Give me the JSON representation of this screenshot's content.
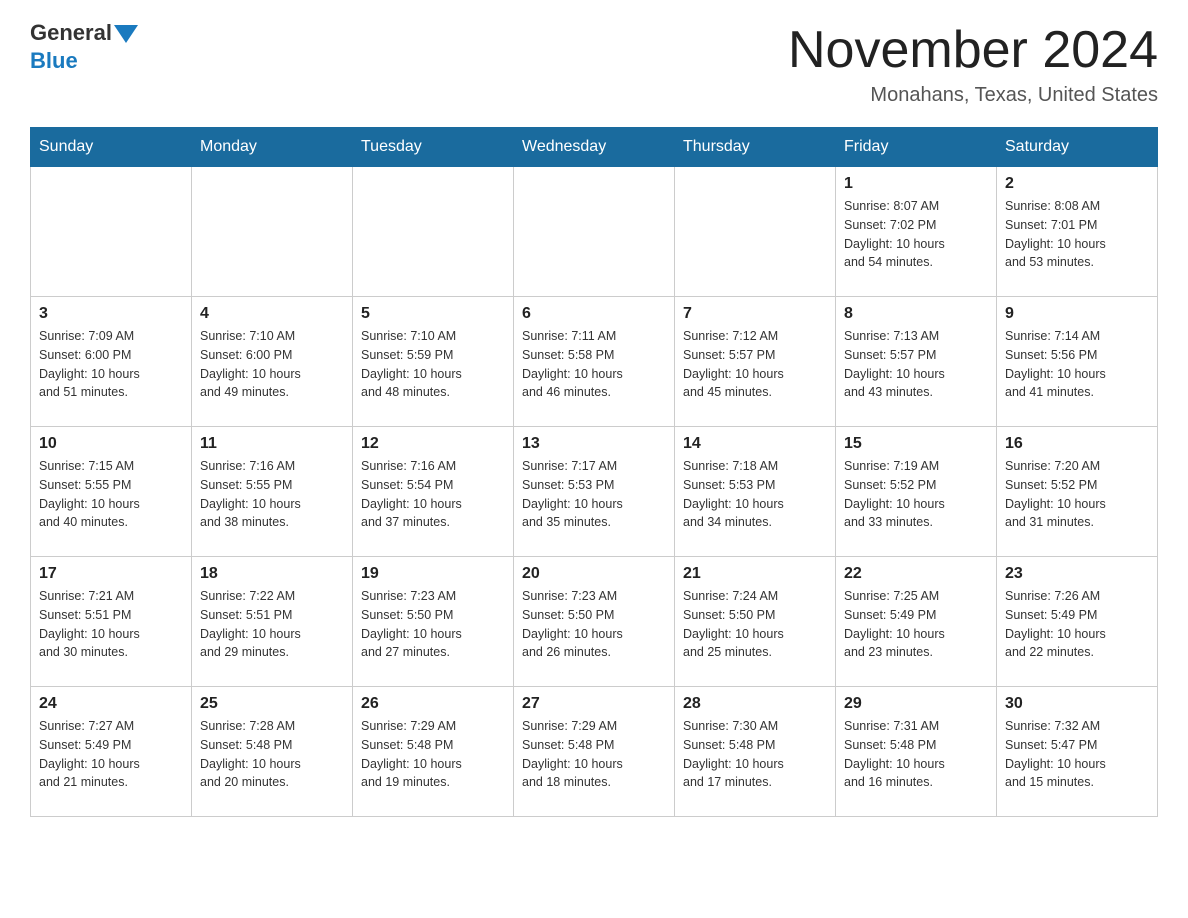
{
  "header": {
    "logo_general": "General",
    "logo_blue": "Blue",
    "title": "November 2024",
    "subtitle": "Monahans, Texas, United States"
  },
  "weekdays": [
    "Sunday",
    "Monday",
    "Tuesday",
    "Wednesday",
    "Thursday",
    "Friday",
    "Saturday"
  ],
  "weeks": [
    [
      {
        "day": "",
        "info": ""
      },
      {
        "day": "",
        "info": ""
      },
      {
        "day": "",
        "info": ""
      },
      {
        "day": "",
        "info": ""
      },
      {
        "day": "",
        "info": ""
      },
      {
        "day": "1",
        "info": "Sunrise: 8:07 AM\nSunset: 7:02 PM\nDaylight: 10 hours\nand 54 minutes."
      },
      {
        "day": "2",
        "info": "Sunrise: 8:08 AM\nSunset: 7:01 PM\nDaylight: 10 hours\nand 53 minutes."
      }
    ],
    [
      {
        "day": "3",
        "info": "Sunrise: 7:09 AM\nSunset: 6:00 PM\nDaylight: 10 hours\nand 51 minutes."
      },
      {
        "day": "4",
        "info": "Sunrise: 7:10 AM\nSunset: 6:00 PM\nDaylight: 10 hours\nand 49 minutes."
      },
      {
        "day": "5",
        "info": "Sunrise: 7:10 AM\nSunset: 5:59 PM\nDaylight: 10 hours\nand 48 minutes."
      },
      {
        "day": "6",
        "info": "Sunrise: 7:11 AM\nSunset: 5:58 PM\nDaylight: 10 hours\nand 46 minutes."
      },
      {
        "day": "7",
        "info": "Sunrise: 7:12 AM\nSunset: 5:57 PM\nDaylight: 10 hours\nand 45 minutes."
      },
      {
        "day": "8",
        "info": "Sunrise: 7:13 AM\nSunset: 5:57 PM\nDaylight: 10 hours\nand 43 minutes."
      },
      {
        "day": "9",
        "info": "Sunrise: 7:14 AM\nSunset: 5:56 PM\nDaylight: 10 hours\nand 41 minutes."
      }
    ],
    [
      {
        "day": "10",
        "info": "Sunrise: 7:15 AM\nSunset: 5:55 PM\nDaylight: 10 hours\nand 40 minutes."
      },
      {
        "day": "11",
        "info": "Sunrise: 7:16 AM\nSunset: 5:55 PM\nDaylight: 10 hours\nand 38 minutes."
      },
      {
        "day": "12",
        "info": "Sunrise: 7:16 AM\nSunset: 5:54 PM\nDaylight: 10 hours\nand 37 minutes."
      },
      {
        "day": "13",
        "info": "Sunrise: 7:17 AM\nSunset: 5:53 PM\nDaylight: 10 hours\nand 35 minutes."
      },
      {
        "day": "14",
        "info": "Sunrise: 7:18 AM\nSunset: 5:53 PM\nDaylight: 10 hours\nand 34 minutes."
      },
      {
        "day": "15",
        "info": "Sunrise: 7:19 AM\nSunset: 5:52 PM\nDaylight: 10 hours\nand 33 minutes."
      },
      {
        "day": "16",
        "info": "Sunrise: 7:20 AM\nSunset: 5:52 PM\nDaylight: 10 hours\nand 31 minutes."
      }
    ],
    [
      {
        "day": "17",
        "info": "Sunrise: 7:21 AM\nSunset: 5:51 PM\nDaylight: 10 hours\nand 30 minutes."
      },
      {
        "day": "18",
        "info": "Sunrise: 7:22 AM\nSunset: 5:51 PM\nDaylight: 10 hours\nand 29 minutes."
      },
      {
        "day": "19",
        "info": "Sunrise: 7:23 AM\nSunset: 5:50 PM\nDaylight: 10 hours\nand 27 minutes."
      },
      {
        "day": "20",
        "info": "Sunrise: 7:23 AM\nSunset: 5:50 PM\nDaylight: 10 hours\nand 26 minutes."
      },
      {
        "day": "21",
        "info": "Sunrise: 7:24 AM\nSunset: 5:50 PM\nDaylight: 10 hours\nand 25 minutes."
      },
      {
        "day": "22",
        "info": "Sunrise: 7:25 AM\nSunset: 5:49 PM\nDaylight: 10 hours\nand 23 minutes."
      },
      {
        "day": "23",
        "info": "Sunrise: 7:26 AM\nSunset: 5:49 PM\nDaylight: 10 hours\nand 22 minutes."
      }
    ],
    [
      {
        "day": "24",
        "info": "Sunrise: 7:27 AM\nSunset: 5:49 PM\nDaylight: 10 hours\nand 21 minutes."
      },
      {
        "day": "25",
        "info": "Sunrise: 7:28 AM\nSunset: 5:48 PM\nDaylight: 10 hours\nand 20 minutes."
      },
      {
        "day": "26",
        "info": "Sunrise: 7:29 AM\nSunset: 5:48 PM\nDaylight: 10 hours\nand 19 minutes."
      },
      {
        "day": "27",
        "info": "Sunrise: 7:29 AM\nSunset: 5:48 PM\nDaylight: 10 hours\nand 18 minutes."
      },
      {
        "day": "28",
        "info": "Sunrise: 7:30 AM\nSunset: 5:48 PM\nDaylight: 10 hours\nand 17 minutes."
      },
      {
        "day": "29",
        "info": "Sunrise: 7:31 AM\nSunset: 5:48 PM\nDaylight: 10 hours\nand 16 minutes."
      },
      {
        "day": "30",
        "info": "Sunrise: 7:32 AM\nSunset: 5:47 PM\nDaylight: 10 hours\nand 15 minutes."
      }
    ]
  ]
}
